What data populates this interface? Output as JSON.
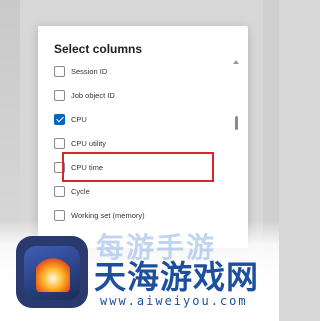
{
  "dialog": {
    "title": "Select columns",
    "items": [
      {
        "label": "Session ID",
        "checked": false
      },
      {
        "label": "Job object ID",
        "checked": false
      },
      {
        "label": "CPU",
        "checked": true
      },
      {
        "label": "CPU utility",
        "checked": false
      },
      {
        "label": "CPU time",
        "checked": false
      },
      {
        "label": "Cycle",
        "checked": false
      },
      {
        "label": "Working set (memory)",
        "checked": false
      }
    ]
  },
  "colors": {
    "accent": "#0067c0",
    "highlight": "#d6262d"
  },
  "watermark": {
    "top_text": "每游手游",
    "main_text": "天海游戏网",
    "url": "www.aiweiyou.com"
  }
}
